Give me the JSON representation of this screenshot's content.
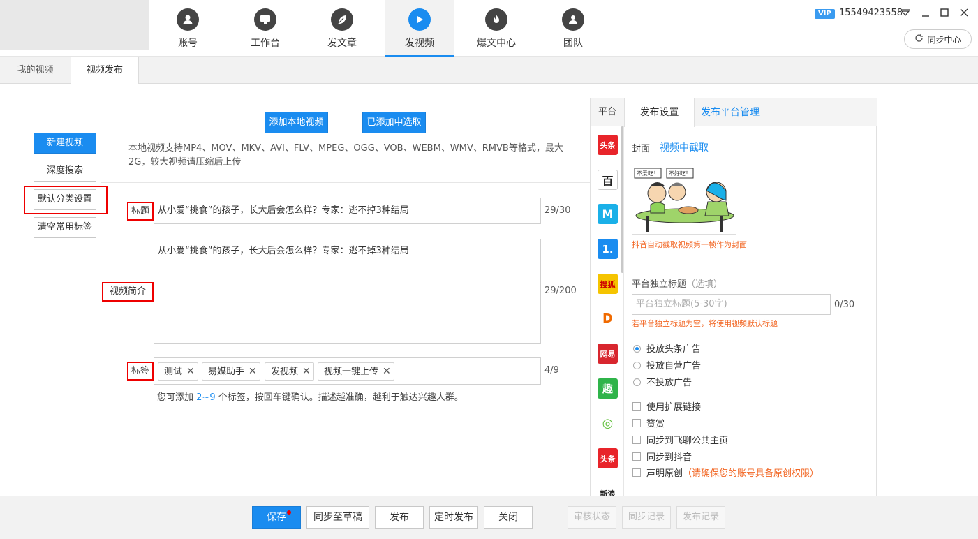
{
  "top_nav": [
    {
      "label": "账号",
      "icon": "user-icon"
    },
    {
      "label": "工作台",
      "icon": "monitor-icon"
    },
    {
      "label": "发文章",
      "icon": "feather-icon"
    },
    {
      "label": "发视频",
      "icon": "play-icon",
      "active": true
    },
    {
      "label": "爆文中心",
      "icon": "fire-icon"
    },
    {
      "label": "团队",
      "icon": "team-icon"
    }
  ],
  "account": {
    "vip": "VIP",
    "phone": "15549423558"
  },
  "sync_center": "同步中心",
  "page_tabs": [
    "我的视频",
    "视频发布"
  ],
  "left_actions": {
    "new_video": "新建视频",
    "deep_search": "深度搜索",
    "default_category": "默认分类设置",
    "clear_tags": "清空常用标签"
  },
  "upload": {
    "add_local": "添加本地视频",
    "pick_added": "已添加中选取",
    "hint": "本地视频支持MP4、MOV、MKV、AVI、FLV、MPEG、OGG、VOB、WEBM、WMV、RMVB等格式，最大2G，较大视频请压缩后上传"
  },
  "form": {
    "title_label": "标题",
    "title_value": "从小爱“挑食”的孩子，长大后会怎么样？专家：逃不掉3种结局",
    "title_count": "29/30",
    "intro_label": "视频简介",
    "intro_value": "从小爱“挑食”的孩子，长大后会怎么样？专家：逃不掉3种结局",
    "intro_count": "29/200",
    "tags_label": "标签",
    "tags": [
      "测试",
      "易媒助手",
      "发视频",
      "视频一键上传"
    ],
    "tags_count": "4/9",
    "tags_hint_pre": "您可添加",
    "tags_hint_range": "2~9",
    "tags_hint_post": "个标签，按回车键确认。描述越准确，越利于触达兴趣人群。"
  },
  "right_panel": {
    "tabs": [
      "平台",
      "发布设置",
      "发布平台管理"
    ],
    "platforms": [
      {
        "name": "头条",
        "color": "#e8242a"
      },
      {
        "name": "百",
        "color": "#ffffff"
      },
      {
        "name": "M",
        "color": "#1ab0e8"
      },
      {
        "name": "1.",
        "color": "#1a8cf0"
      },
      {
        "name": "搜狐",
        "color": "#f5c400"
      },
      {
        "name": "D",
        "color": "#ffffff"
      },
      {
        "name": "网易",
        "color": "#d8262e"
      },
      {
        "name": "趣",
        "color": "#2fb44a"
      },
      {
        "name": "◎",
        "color": "#ffffff"
      },
      {
        "name": "头条",
        "color": "#e8242a"
      },
      {
        "name": "新浪",
        "color": "#ffffff"
      }
    ],
    "cover_label": "封面",
    "cover_capture": "视频中截取",
    "cover_bubble1": "不爱吃！",
    "cover_bubble2": "不好吃！",
    "cover_note": "抖音自动截取视频第一帧作为封面",
    "indep_title_label": "平台独立标题",
    "indep_title_opt": "（选填）",
    "indep_title_placeholder": "平台独立标题(5-30字)",
    "indep_title_count": "0/30",
    "indep_title_note": "若平台独立标题为空，将使用视频默认标题",
    "ad_options": [
      {
        "label": "投放头条广告",
        "selected": true
      },
      {
        "label": "投放自营广告",
        "selected": false
      },
      {
        "label": "不投放广告",
        "selected": false
      }
    ],
    "checkboxes": [
      "使用扩展链接",
      "赞赏",
      "同步到飞聊公共主页",
      "同步到抖音"
    ],
    "original_label": "声明原创",
    "original_note": "（请确保您的账号具备原创权限）"
  },
  "footer": {
    "save": "保存",
    "sync_draft": "同步至草稿",
    "publish": "发布",
    "schedule": "定时发布",
    "close": "关闭",
    "review": "审核状态",
    "sync_log": "同步记录",
    "publish_log": "发布记录"
  },
  "colors": {
    "accent": "#1a8cf0",
    "warn": "#f26522",
    "highlight": "#e00000"
  }
}
